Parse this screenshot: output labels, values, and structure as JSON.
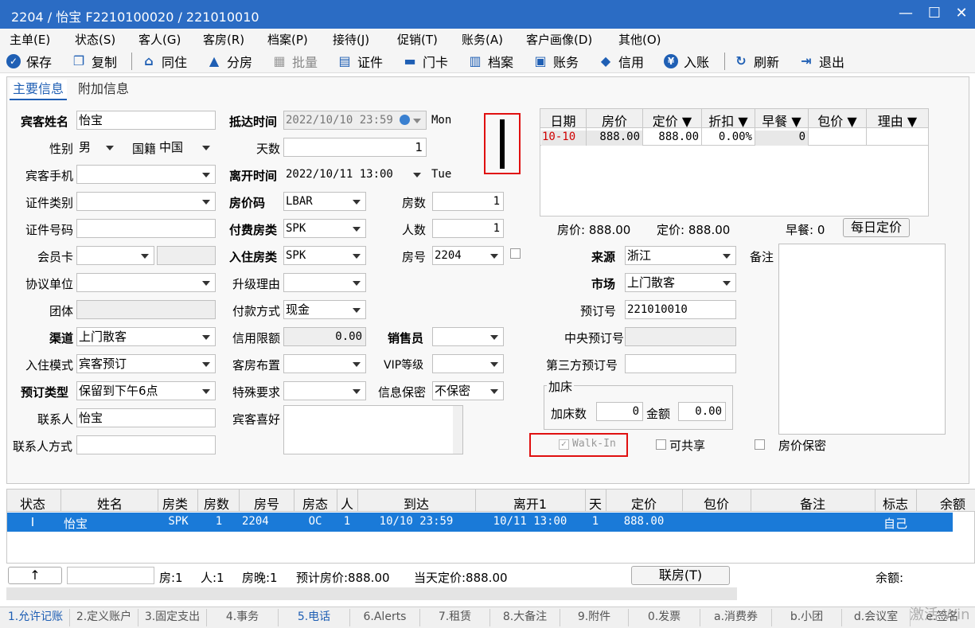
{
  "window": {
    "title": "2204 / 怡宝 F2210100020 / 221010010",
    "min": "—",
    "max": "☐",
    "close": "✕"
  },
  "menu": [
    "主单(E)",
    "状态(S)",
    "客人(G)",
    "客房(R)",
    "档案(P)",
    "接待(J)",
    "促销(T)",
    "账务(A)",
    "客户画像(D)",
    "其他(O)"
  ],
  "toolbar": {
    "save": "保存",
    "copy": "复制",
    "cohabit": "同住",
    "split": "分房",
    "batch": "批量",
    "cert": "证件",
    "card": "门卡",
    "file": "档案",
    "account": "账务",
    "credit": "信用",
    "post": "入账",
    "refresh": "刷新",
    "exit": "退出"
  },
  "tabs": {
    "main": "主要信息",
    "extra": "附加信息"
  },
  "form": {
    "guest_name_label": "宾客姓名",
    "guest_name": "怡宝",
    "gender_label": "性别",
    "gender": "男",
    "nation_label": "国籍",
    "nation": "中国",
    "mobile_label": "宾客手机",
    "idtype_label": "证件类别",
    "idno_label": "证件号码",
    "member_label": "会员卡",
    "agreement_label": "协议单位",
    "group_label": "团体",
    "channel_label": "渠道",
    "channel": "上门散客",
    "checkin_mode_label": "入住模式",
    "checkin_mode": "宾客预订",
    "booking_type_label": "预订类型",
    "booking_type": "保留到下午6点",
    "contact_label": "联系人",
    "contact": "怡宝",
    "contact_way_label": "联系人方式",
    "arrive_label": "抵达时间",
    "arrive": "2022/10/10 23:59",
    "arrive_day": "Mon",
    "days_label": "天数",
    "days": "1",
    "depart_label": "离开时间",
    "depart": "2022/10/11 13:00",
    "depart_day": "Tue",
    "ratecode_label": "房价码",
    "ratecode": "LBAR",
    "paytype_label": "付费房类",
    "paytype": "SPK",
    "roomtype_label": "入住房类",
    "roomtype": "SPK",
    "upgrade_label": "升级理由",
    "paymethod_label": "付款方式",
    "paymethod": "现金",
    "credit_label": "信用限额",
    "credit": "0.00",
    "layout_label": "客房布置",
    "special_label": "特殊要求",
    "pref_label": "宾客喜好",
    "rooms_label": "房数",
    "rooms": "1",
    "persons_label": "人数",
    "persons": "1",
    "roomno_label": "房号",
    "roomno": "2204",
    "sales_label": "销售员",
    "vip_label": "VIP等级",
    "privacy_label": "信息保密",
    "privacy": "不保密",
    "source_label": "来源",
    "source": "浙江",
    "market_label": "市场",
    "market": "上门散客",
    "resno_label": "预订号",
    "resno": "221010010",
    "central_label": "中央预订号",
    "third_label": "第三方预订号",
    "remark_label": "备注",
    "extrabed_title": "加床",
    "extrabed_label": "加床数",
    "extrabed": "0",
    "amount_label": "金额",
    "amount": "0.00",
    "walkin": "Walk-In",
    "share": "可共享",
    "rate_secret": "房价保密"
  },
  "rategrid": {
    "headers": [
      "日期",
      "房价",
      "定价 ▼",
      "折扣 ▼",
      "早餐 ▼",
      "包价 ▼",
      "理由 ▼"
    ],
    "row": [
      "10-10",
      "888.00",
      "888.00",
      "0.00%",
      "0",
      "",
      ""
    ],
    "summary_rate": "房价: 888.00",
    "summary_price": "定价: 888.00",
    "summary_bf": "早餐: 0",
    "daily_btn": "每日定价"
  },
  "list": {
    "headers": [
      "状态",
      "姓名",
      "房类",
      "房数",
      "房号",
      "房态",
      "人",
      "到达",
      "离开1",
      "天",
      "定价",
      "包价",
      "备注",
      "标志",
      "余额"
    ],
    "row": [
      "I",
      "怡宝",
      "SPK",
      "1",
      "2204",
      "OC",
      "1",
      "10/10 23:59",
      "10/11 13:00",
      "1",
      "888.00",
      "",
      "",
      "自己",
      ""
    ]
  },
  "footer": {
    "up": "↑",
    "rooms": "房:1",
    "persons": "人:1",
    "nights": "房晚:1",
    "est": "预计房价:888.00",
    "today": "当天定价:888.00",
    "link": "联房(T)",
    "balance": "余额:"
  },
  "bottom_tabs": [
    "1.允许记账",
    "2.定义账户",
    "3.固定支出",
    "4.事务",
    "5.电话",
    "6.Alerts",
    "7.租赁",
    "8.大备注",
    "9.附件",
    "0.发票",
    "a.消费券",
    "b.小团",
    "d.会议室",
    "e.签名"
  ],
  "watermark": "激活 Win"
}
